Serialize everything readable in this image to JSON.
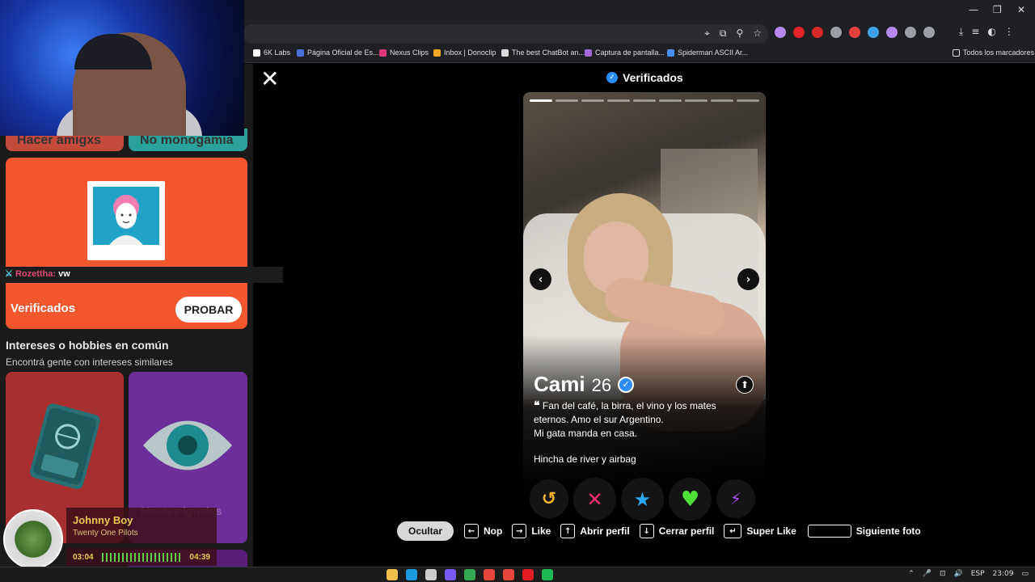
{
  "browser": {
    "window_controls": [
      "—",
      "❐",
      "✕"
    ],
    "omnibox_icons": [
      "⌖",
      "⧉",
      "⚲",
      "☆"
    ],
    "extension_colors": [
      "#b488f0",
      "#e5242c",
      "#d62a2a",
      "#9aa0a6",
      "#e63e3e",
      "#39a1e5",
      "#b488f0",
      "#9aa0a6",
      "#9aa0a6"
    ],
    "toolbar_icons": [
      "⤓",
      "≡",
      "◐",
      "⋮"
    ],
    "bookmarks": [
      {
        "label": "6K Labs",
        "color": "#ffffff"
      },
      {
        "label": "Página Oficial de Es...",
        "color": "#4a6fd9"
      },
      {
        "label": "Nexus Clips",
        "color": "#e0357a"
      },
      {
        "label": "Inbox | Donoclip",
        "color": "#f2a51f"
      },
      {
        "label": "The best ChatBot an...",
        "color": "#dddddd"
      },
      {
        "label": "Captura de pantalla...",
        "color": "#a06bd6"
      },
      {
        "label": "Spiderman ASCII Ar...",
        "color": "#4a8cf0"
      }
    ],
    "all_bookmarks": "Todos los marcadores"
  },
  "sidebar": {
    "top_cards": [
      {
        "label": "Hacer amigxs",
        "color": "#c44a3c"
      },
      {
        "label": "No monogamia",
        "color": "#2aa19b"
      }
    ],
    "verified_card": {
      "title": "Verificados",
      "button": "PROBAR"
    },
    "chat": {
      "user": "Rozettha:",
      "message": "vw"
    },
    "interests": {
      "title": "Intereses o hobbies en común",
      "subtitle": "Encontrá gente con intereses similares",
      "tile_label": "Mentes iguales"
    }
  },
  "profile": {
    "header": "Verificados",
    "close_icon": "✕",
    "name": "Cami",
    "age": "26",
    "bio_quote": "❝",
    "bio_lines": [
      "Fan del café, la birra, el vino y los mates",
      "eternos. Amo el sur Argentino.",
      "Mi gata manda en casa."
    ],
    "extra": "Hincha de river y airbag",
    "photo_count": 9,
    "active_photo": 1,
    "prev_icon": "‹",
    "next_icon": "›",
    "expand_icon": "⬆"
  },
  "actions": [
    {
      "name": "rewind",
      "glyph": "↺",
      "color": "#f2b32a"
    },
    {
      "name": "nope",
      "glyph": "✕",
      "color": "#ff2d75"
    },
    {
      "name": "super-like",
      "glyph": "★",
      "color": "#2aa9f2"
    },
    {
      "name": "like",
      "glyph": "♥",
      "color": "#4fe03a"
    },
    {
      "name": "boost",
      "glyph": "⚡",
      "color": "#a84df5"
    }
  ],
  "hints": {
    "hide": "Ocultar",
    "items": [
      {
        "key": "←",
        "label": "Nop"
      },
      {
        "key": "→",
        "label": "Like"
      },
      {
        "key": "↑",
        "label": "Abrir perfil"
      },
      {
        "key": "↓",
        "label": "Cerrar perfil"
      },
      {
        "key": "↵",
        "label": "Super Like"
      },
      {
        "key": "",
        "label": "Siguiente foto"
      }
    ]
  },
  "now_playing": {
    "title": "Johnny Boy",
    "artist": "Twenty One Pilots",
    "elapsed": "03:04",
    "total": "04:39",
    "progress": 0.66
  },
  "taskbar": {
    "app_colors": [
      "#f2c04a",
      "#1b9ae0",
      "#cccccc",
      "#7a5af5",
      "#34a853",
      "#e8453c",
      "#e8453c",
      "#e01b24",
      "#1db954"
    ],
    "tray": {
      "lang": "ESP",
      "time": "23:09"
    },
    "tray_icons": [
      "⌃",
      "🎤",
      "⊡",
      "🔊"
    ]
  }
}
